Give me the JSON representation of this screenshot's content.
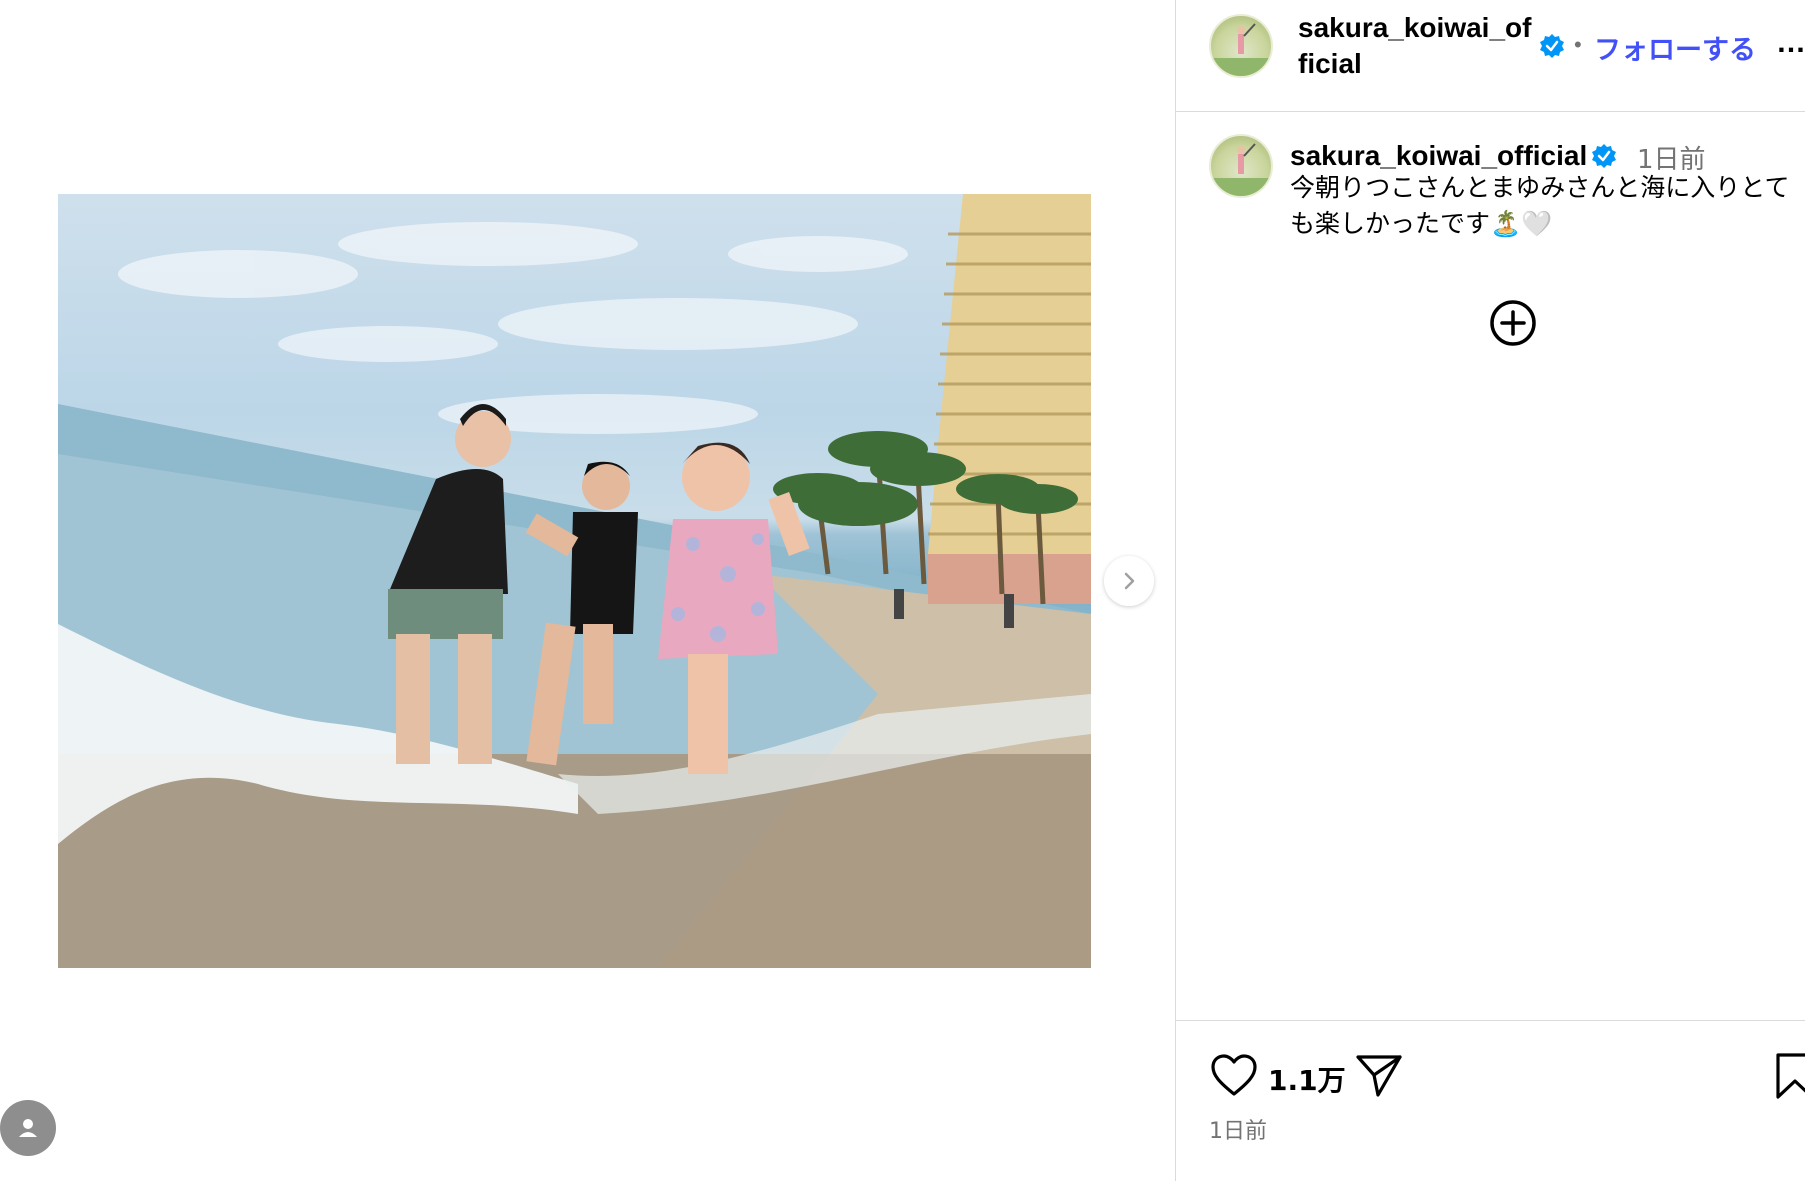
{
  "post": {
    "username": "sakura_koiwai_official",
    "header_username": "sakura_koiwai_official",
    "follow_label": "フォローする",
    "more_label": "…",
    "separator": "•",
    "caption_time": "1日前",
    "caption_text": "今朝りつこさんとまゆみさんと海に入りとても楽しかったです🏝️🤍",
    "likes": "1.1万",
    "post_time": "1日前"
  },
  "icons": {
    "verified": "verified-badge-icon",
    "next": "chevron-right-icon",
    "add": "add-circle-icon",
    "like": "heart-icon",
    "share": "paper-plane-icon",
    "save": "bookmark-icon",
    "user": "user-silhouette-icon"
  },
  "colors": {
    "follow_blue": "#4150f7",
    "verified_blue": "#0095f6",
    "muted_text": "#737373",
    "divider": "#dbdbdb"
  }
}
